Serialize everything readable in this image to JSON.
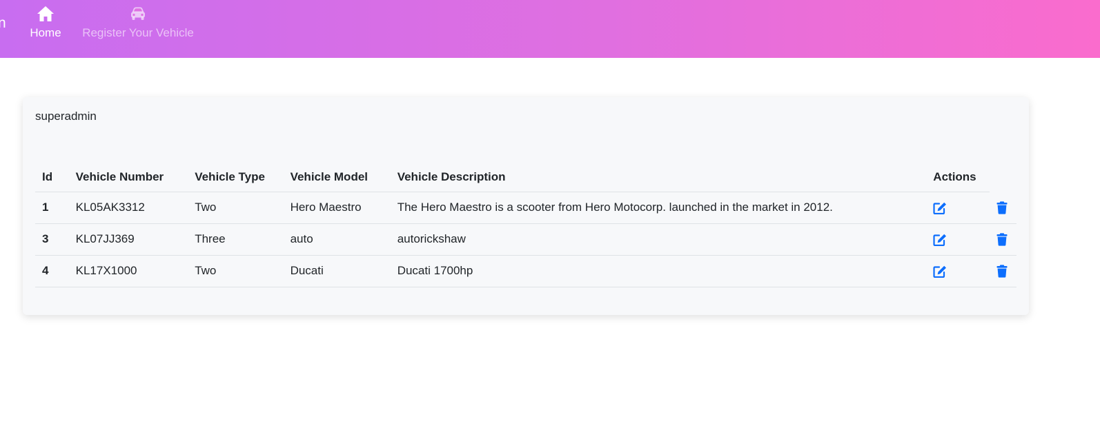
{
  "navbar": {
    "brand_tail": "n",
    "home": {
      "label": "Home",
      "icon": "home-icon"
    },
    "register": {
      "label": "Register Your Vehicle",
      "icon": "car-icon"
    }
  },
  "card": {
    "username": "superadmin"
  },
  "table": {
    "headers": {
      "id": "Id",
      "vehicle_number": "Vehicle Number",
      "vehicle_type": "Vehicle Type",
      "vehicle_model": "Vehicle Model",
      "vehicle_description": "Vehicle Description",
      "actions": "Actions"
    },
    "rows": [
      {
        "id": "1",
        "vehicle_number": "KL05AK3312",
        "vehicle_type": "Two",
        "vehicle_model": "Hero Maestro",
        "vehicle_description": "The Hero Maestro is a scooter from Hero Motocorp. launched in the market in 2012."
      },
      {
        "id": "3",
        "vehicle_number": "KL07JJ369",
        "vehicle_type": "Three",
        "vehicle_model": "auto",
        "vehicle_description": "autorickshaw"
      },
      {
        "id": "4",
        "vehicle_number": "KL17X1000",
        "vehicle_type": "Two",
        "vehicle_model": "Ducati",
        "vehicle_description": "Ducati 1700hp"
      }
    ],
    "action_icons": {
      "edit": "edit-icon",
      "delete": "trash-icon"
    }
  },
  "colors": {
    "accent_blue": "#0d6efd",
    "gradient_start": "#c86df0",
    "gradient_end": "#fa6ccd"
  }
}
